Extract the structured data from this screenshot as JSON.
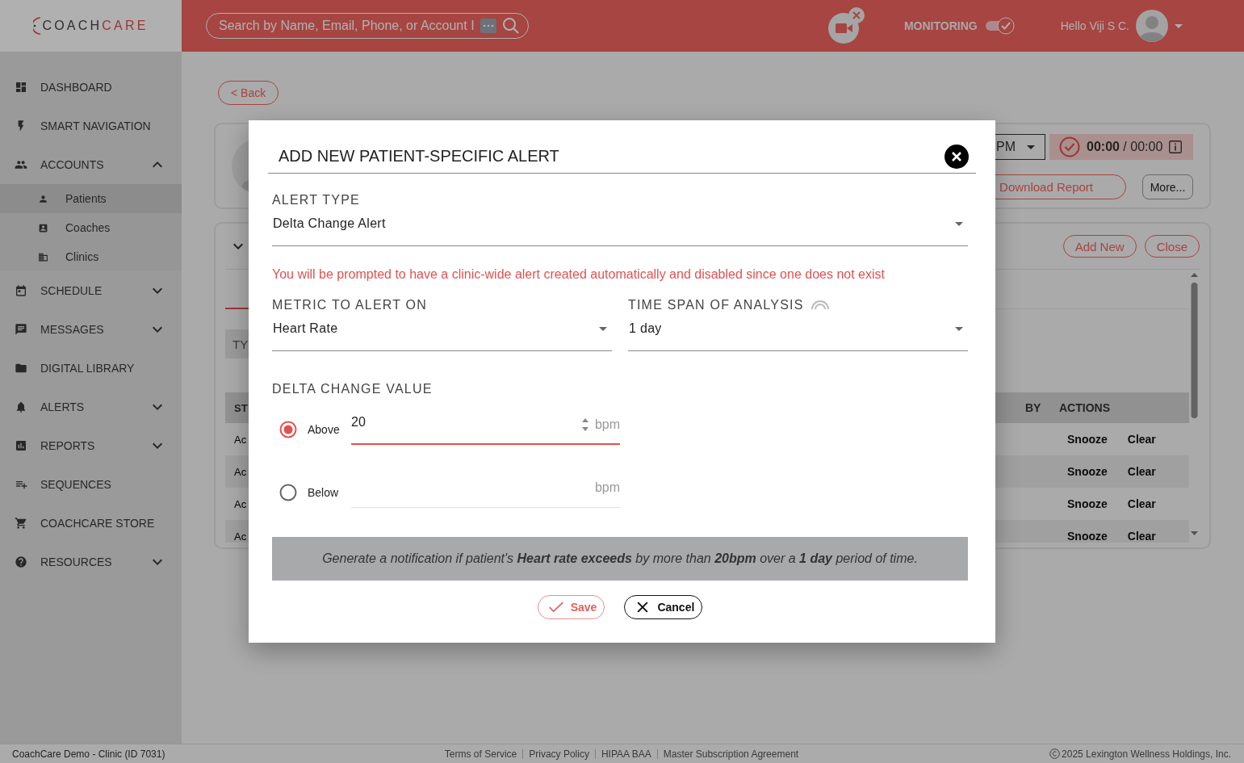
{
  "header": {
    "logo": {
      "primary": "COACH",
      "accent": "CARE"
    },
    "search": {
      "placeholder": "Search by Name, Email, Phone, or Account I"
    },
    "monitoring": {
      "label": "MONITORING",
      "on": true
    },
    "user": {
      "greeting": "Hello Viji S C."
    }
  },
  "sidebar": {
    "items": [
      {
        "label": "DASHBOARD",
        "kind": "link"
      },
      {
        "label": "SMART NAVIGATION",
        "kind": "link"
      },
      {
        "label": "ACCOUNTS",
        "kind": "group",
        "expanded": true,
        "children": [
          {
            "label": "Patients",
            "selected": true
          },
          {
            "label": "Coaches",
            "selected": false
          },
          {
            "label": "Clinics",
            "selected": false
          }
        ]
      },
      {
        "label": "SCHEDULE",
        "kind": "group",
        "expanded": false
      },
      {
        "label": "MESSAGES",
        "kind": "group",
        "expanded": false
      },
      {
        "label": "DIGITAL LIBRARY",
        "kind": "link"
      },
      {
        "label": "ALERTS",
        "kind": "group",
        "expanded": false
      },
      {
        "label": "REPORTS",
        "kind": "group",
        "expanded": false
      },
      {
        "label": "SEQUENCES",
        "kind": "link"
      },
      {
        "label": "COACHCARE STORE",
        "kind": "link"
      },
      {
        "label": "RESOURCES",
        "kind": "group",
        "expanded": false
      }
    ]
  },
  "main": {
    "back_button": "< Back",
    "patient_card": {
      "time_select": "PM",
      "timer": "**00:00** / 00:00",
      "buttons": [
        "Download Report",
        "More..."
      ]
    },
    "alerts_panel": {
      "buttons": [
        "Add New",
        "Close"
      ],
      "filter": "TY",
      "table": {
        "columns": [
          "ST",
          "BY",
          "ACTIONS"
        ],
        "rows": [
          {
            "cells": [
              "Ac"
            ],
            "actions": [
              "Snooze",
              "Clear"
            ]
          },
          {
            "cells": [
              "Ac"
            ],
            "actions": [
              "Snooze",
              "Clear"
            ]
          },
          {
            "cells": [
              "Ac"
            ],
            "actions": [
              "Snooze",
              "Clear"
            ]
          },
          {
            "cells": [
              "Ac"
            ],
            "actions": [
              "Snooze",
              "Clear"
            ]
          }
        ]
      }
    }
  },
  "dialog": {
    "title": "ADD NEW PATIENT-SPECIFIC ALERT",
    "alert_type": {
      "label": "ALERT TYPE",
      "value": "Delta Change Alert"
    },
    "warning": "You will be prompted to have a clinic-wide alert created automatically and disabled since one does not exist",
    "metric": {
      "label": "METRIC TO ALERT ON",
      "value": "Heart Rate"
    },
    "time_span": {
      "label": "TIME SPAN OF ANALYSIS",
      "value": "1 day"
    },
    "delta": {
      "label": "DELTA CHANGE VALUE",
      "options": [
        {
          "label": "Above",
          "selected": true,
          "value": "20",
          "unit": "bpm"
        },
        {
          "label": "Below",
          "selected": false,
          "unit": "bpm"
        }
      ]
    },
    "summary": "Generate a notification if patient's **Heart rate exceeds** by more than **20bpm** over a **1 day** period of time.",
    "buttons": [
      {
        "label": "Save",
        "kind": "save"
      },
      {
        "label": "Cancel",
        "kind": "cancel"
      }
    ]
  },
  "footer": {
    "clinic": "CoachCare Demo - Clinic (ID 7031)",
    "links": [
      "Terms of Service",
      "Privacy Policy",
      "HIPAA BAA",
      "Master Subscription Agreement"
    ],
    "copyright": "2025 Lexington Wellness Holdings, Inc."
  }
}
